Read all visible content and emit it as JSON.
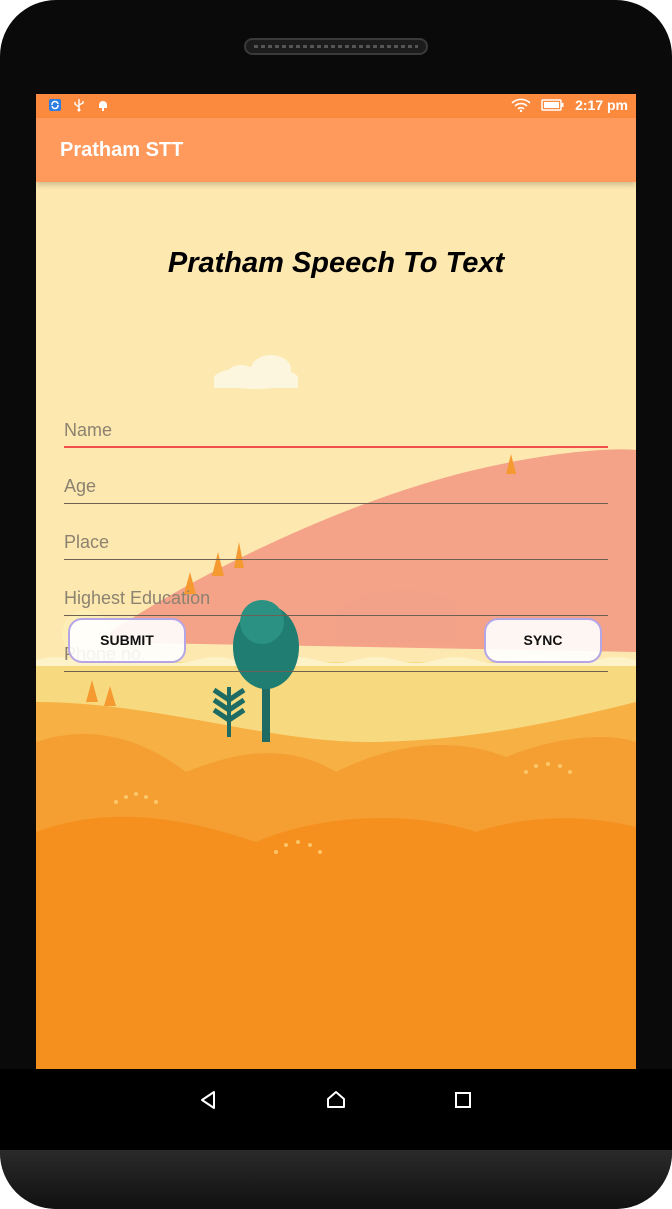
{
  "status_bar": {
    "time": "2:17 pm",
    "left_icons": [
      "sync-notification-icon",
      "usb-icon",
      "android-debug-icon"
    ],
    "right_icons": [
      "wifi-icon",
      "battery-icon"
    ]
  },
  "app_bar": {
    "title": "Pratham STT"
  },
  "main": {
    "heading": "Pratham Speech To Text",
    "fields": [
      {
        "placeholder": "Name",
        "value": ""
      },
      {
        "placeholder": "Age",
        "value": ""
      },
      {
        "placeholder": "Place",
        "value": ""
      },
      {
        "placeholder": "Highest Education",
        "value": ""
      },
      {
        "placeholder": "Phone no.",
        "value": ""
      }
    ],
    "submit_label": "SUBMIT",
    "sync_label": "SYNC"
  },
  "nav_bar": {
    "icons": [
      "back-icon",
      "home-icon",
      "recents-icon"
    ]
  },
  "colors": {
    "status_bar": "#fb8a3e",
    "app_bar": "#ff9a5c",
    "background_sky": "#fde8b0",
    "field_focus_underline": "#f0504a",
    "button_border": "#b4a6e4"
  }
}
